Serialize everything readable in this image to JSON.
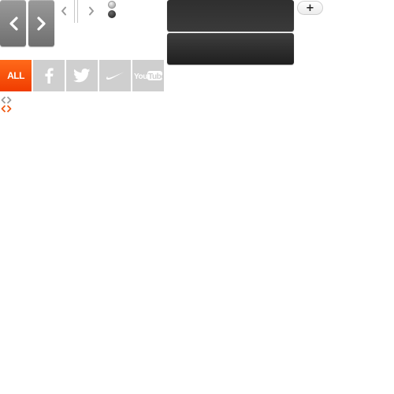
{
  "navigation": {
    "large_prev_icon": "chevron-left-icon",
    "large_next_icon": "chevron-right-icon",
    "small_prev_icon": "chevron-left-icon",
    "small_next_icon": "chevron-right-icon"
  },
  "pagination": {
    "dots": [
      "inactive",
      "active"
    ]
  },
  "panels": {
    "top_color": "#333333",
    "bottom_color": "#2a2a2a"
  },
  "actions": {
    "add_label": "+"
  },
  "filters": {
    "all_label": "ALL",
    "all_color": "#f24a06",
    "inactive_color": "#cfcfcf",
    "items": [
      {
        "icon": "facebook-icon"
      },
      {
        "icon": "twitter-icon"
      },
      {
        "icon": "nike-swoosh-icon"
      },
      {
        "icon": "youtube-icon"
      }
    ]
  },
  "mini_arrows": [
    {
      "color": "#9a9a9a"
    },
    {
      "color": "#f05a14"
    }
  ]
}
